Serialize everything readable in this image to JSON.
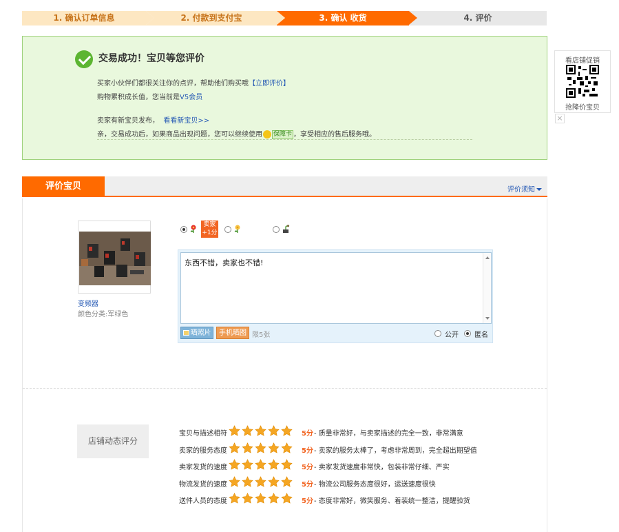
{
  "steps": [
    {
      "label": "1. 确认订单信息",
      "state": "done"
    },
    {
      "label": "2. 付款到支付宝",
      "state": "done"
    },
    {
      "label": "3. 确认 收货",
      "state": "active"
    },
    {
      "label": "4. 评价",
      "state": "todo"
    }
  ],
  "success": {
    "title": "交易成功！宝贝等您评价",
    "line1_text": "买家小伙伴们都很关注你的点评，帮助他们购买哦",
    "line1_link": "【立即评价】",
    "line2_text": "购物累积成长值，您当前是",
    "line2_link": "V5会员",
    "line3_text": "卖家有新宝贝发布，",
    "line3_link": "看看新宝贝>>",
    "line4_pre": "亲，交易成功后，如果商品出现问题，您可以继续使用",
    "line4_badge": "保障卡",
    "line4_post": "，享受相应的售后服务哦。"
  },
  "qr": {
    "top_label": "看店铺促销",
    "bottom_label": "抢降价宝贝",
    "close": "×"
  },
  "review": {
    "tab_label": "评价宝贝",
    "notice_label": "评价须知",
    "product_name": "变频器",
    "product_sku": "颜色分类:军绿色",
    "bonus_line1": "卖家",
    "bonus_line2": "+1分",
    "selected_rating": "good",
    "comment": "东西不错，卖家也不错!",
    "photo_btn": "晒照片",
    "mobile_btn": "手机晒图",
    "limit": "限5张",
    "public_label": "公开",
    "anon_label": "匿名",
    "visibility": "anonymous"
  },
  "store_score": {
    "button": "店铺动态评分",
    "items": [
      {
        "label": "宝贝与描述相符",
        "stars": 5,
        "score": "5分",
        "desc": "- 质量非常好，与卖家描述的完全一致，非常满意"
      },
      {
        "label": "卖家的服务态度",
        "stars": 5,
        "score": "5分",
        "desc": "- 卖家的服务太棒了，考虑非常周到，完全超出期望值"
      },
      {
        "label": "卖家发货的速度",
        "stars": 5,
        "score": "5分",
        "desc": "- 卖家发货速度非常快，包装非常仔细、严实"
      },
      {
        "label": "物流发货的速度",
        "stars": 5,
        "score": "5分",
        "desc": "- 物流公司服务态度很好，运送速度很快"
      },
      {
        "label": "送件人员的态度",
        "stars": 5,
        "score": "5分",
        "desc": "- 态度非常好，微笑服务、着装统一整洁，提醒验货"
      }
    ]
  },
  "colors": {
    "accent": "#ff6a00",
    "success_bg": "#e9f8dd",
    "star": "#f5a623"
  }
}
